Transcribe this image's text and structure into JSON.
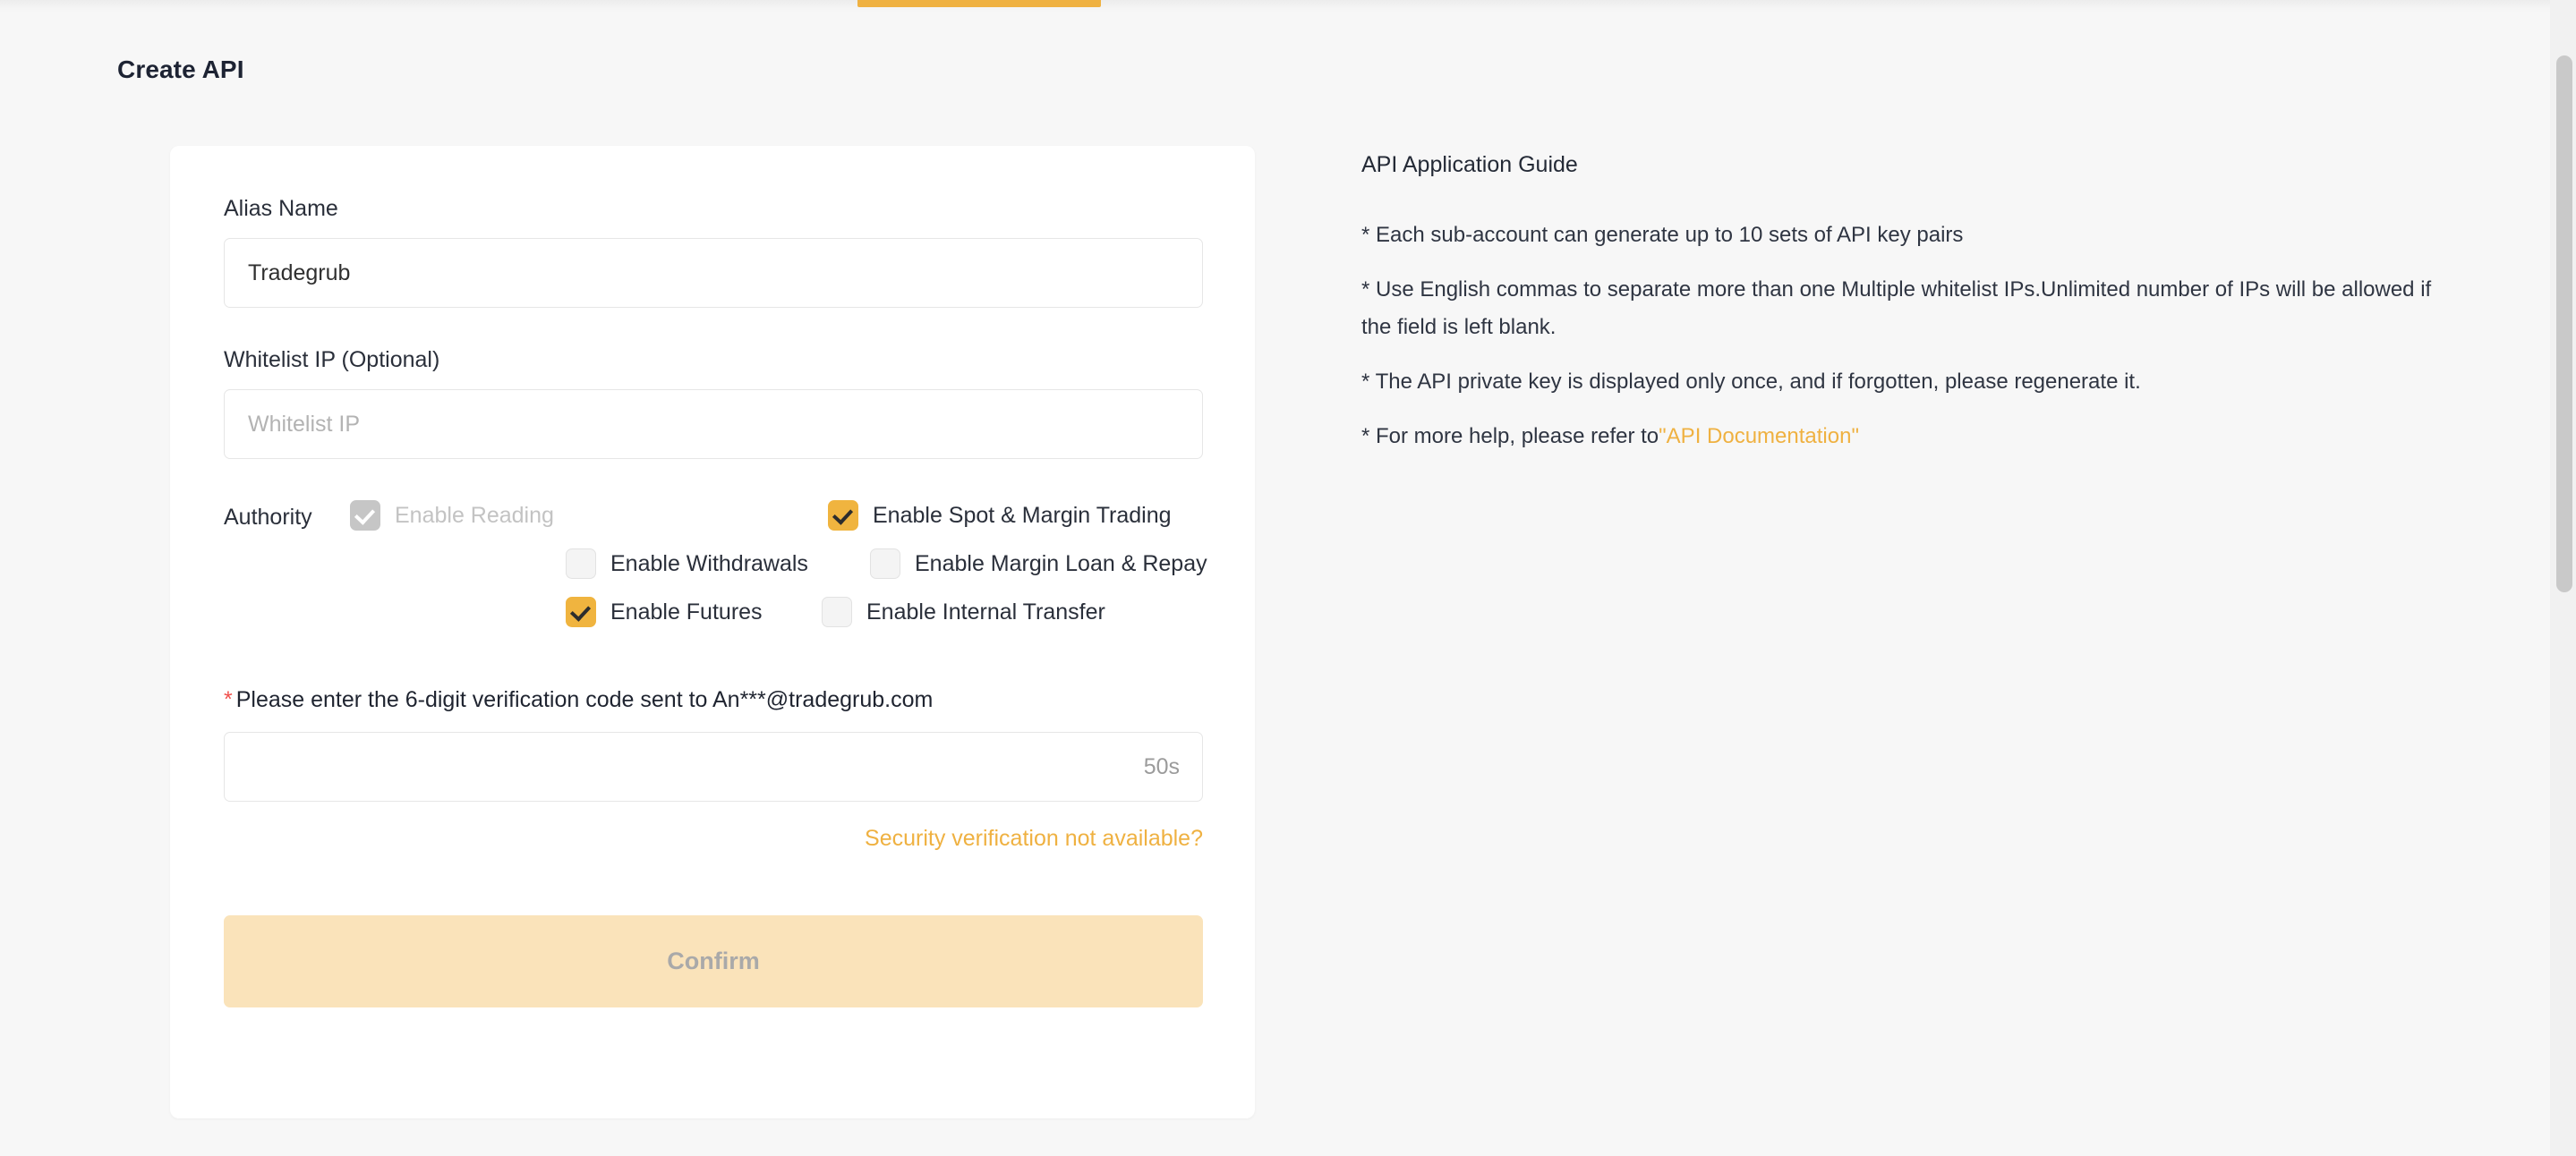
{
  "page": {
    "title": "Create API",
    "accent_color": "#efb141",
    "background_color": "#f7f7f7"
  },
  "form": {
    "alias": {
      "label": "Alias Name",
      "value": "Tradegrub",
      "placeholder": "Alias Name"
    },
    "whitelist": {
      "label": "Whitelist IP (Optional)",
      "value": "",
      "placeholder": "Whitelist IP"
    },
    "authority": {
      "label": "Authority",
      "options": [
        {
          "label": "Enable Reading",
          "checked": true,
          "disabled": true
        },
        {
          "label": "Enable Spot & Margin Trading",
          "checked": true,
          "disabled": false
        },
        {
          "label": "Enable Withdrawals",
          "checked": false,
          "disabled": false
        },
        {
          "label": "Enable Margin Loan & Repay",
          "checked": false,
          "disabled": false
        },
        {
          "label": "Enable Futures",
          "checked": true,
          "disabled": false
        },
        {
          "label": "Enable Internal Transfer",
          "checked": false,
          "disabled": false
        }
      ]
    },
    "verification": {
      "required_marker": "*",
      "label": "Please enter the 6-digit verification code sent to An***@tradegrub.com",
      "value": "",
      "placeholder": "",
      "countdown": "50s",
      "help_link": "Security verification not available?"
    },
    "confirm_label": "Confirm"
  },
  "guide": {
    "title": "API Application Guide",
    "lines": [
      "* Each sub-account can generate up to 10 sets of API key pairs",
      "* Use English commas to separate more than one Multiple whitelist IPs.Unlimited number of IPs will be allowed if the field is left blank.",
      "* The API private key is displayed only once, and if forgotten, please regenerate it."
    ],
    "last_line_prefix": "* For more help, please refer to",
    "last_line_link": "\"API Documentation\""
  }
}
